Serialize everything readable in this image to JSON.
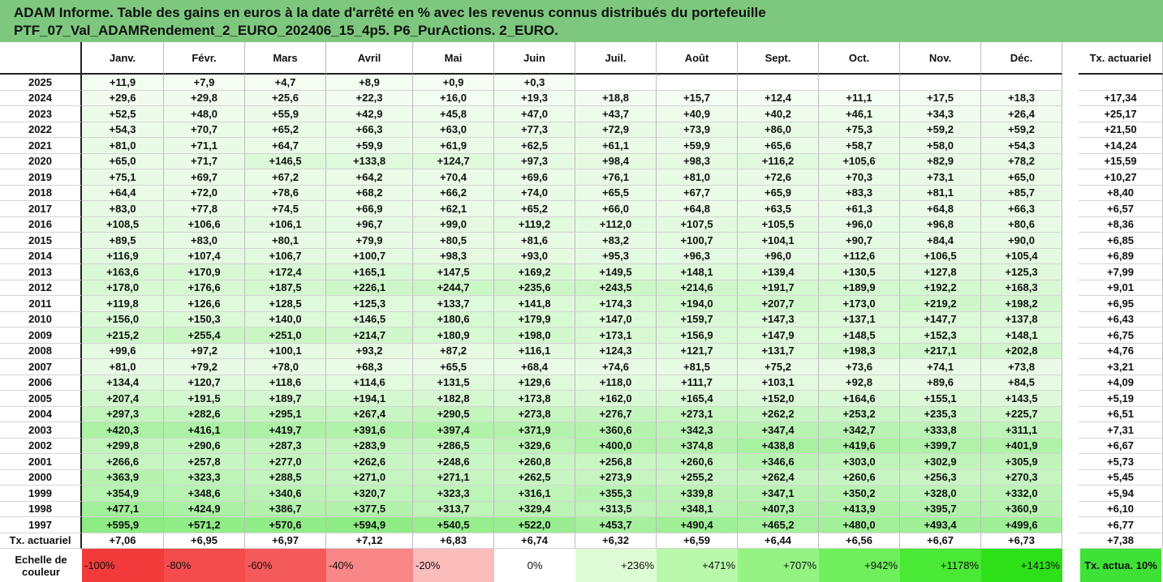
{
  "title": {
    "line1": "ADAM Informe. Table des gains en euros à la date d'arrêté en % avec les revenus connus distribués du portefeuille",
    "line2": "PTF_07_Val_ADAMRendement_2_EURO_202406_15_4p5. P6_PurActions. 2_EURO."
  },
  "months": [
    "Janv.",
    "Févr.",
    "Mars",
    "Avril",
    "Mai",
    "Juin",
    "Juil.",
    "Août",
    "Sept.",
    "Oct.",
    "Nov.",
    "Déc."
  ],
  "rate_header": "Tx. actuariel",
  "rows": [
    {
      "year": "2025",
      "values": [
        "+11,9",
        "+7,9",
        "+4,7",
        "+8,9",
        "+0,9",
        "+0,3",
        "",
        "",
        "",
        "",
        "",
        ""
      ],
      "rate": ""
    },
    {
      "year": "2024",
      "values": [
        "+29,6",
        "+29,8",
        "+25,6",
        "+22,3",
        "+16,0",
        "+19,3",
        "+18,8",
        "+15,7",
        "+12,4",
        "+11,1",
        "+17,5",
        "+18,3"
      ],
      "rate": "+17,34"
    },
    {
      "year": "2023",
      "values": [
        "+52,5",
        "+48,0",
        "+55,9",
        "+42,9",
        "+45,8",
        "+47,0",
        "+43,7",
        "+40,9",
        "+40,2",
        "+46,1",
        "+34,3",
        "+26,4"
      ],
      "rate": "+25,17"
    },
    {
      "year": "2022",
      "values": [
        "+54,3",
        "+70,7",
        "+65,2",
        "+66,3",
        "+63,0",
        "+77,3",
        "+72,9",
        "+73,9",
        "+86,0",
        "+75,3",
        "+59,2",
        "+59,2"
      ],
      "rate": "+21,50"
    },
    {
      "year": "2021",
      "values": [
        "+81,0",
        "+71,1",
        "+64,7",
        "+59,9",
        "+61,9",
        "+62,5",
        "+61,1",
        "+59,9",
        "+65,6",
        "+58,7",
        "+58,0",
        "+54,3"
      ],
      "rate": "+14,24"
    },
    {
      "year": "2020",
      "values": [
        "+65,0",
        "+71,7",
        "+146,5",
        "+133,8",
        "+124,7",
        "+97,3",
        "+98,4",
        "+98,3",
        "+116,2",
        "+105,6",
        "+82,9",
        "+78,2"
      ],
      "rate": "+15,59"
    },
    {
      "year": "2019",
      "values": [
        "+75,1",
        "+69,7",
        "+67,2",
        "+64,2",
        "+70,4",
        "+69,6",
        "+76,1",
        "+81,0",
        "+72,6",
        "+70,3",
        "+73,1",
        "+65,0"
      ],
      "rate": "+10,27"
    },
    {
      "year": "2018",
      "values": [
        "+64,4",
        "+72,0",
        "+78,6",
        "+68,2",
        "+66,2",
        "+74,0",
        "+65,5",
        "+67,7",
        "+65,9",
        "+83,3",
        "+81,1",
        "+85,7"
      ],
      "rate": "+8,40"
    },
    {
      "year": "2017",
      "values": [
        "+83,0",
        "+77,8",
        "+74,5",
        "+66,9",
        "+62,1",
        "+65,2",
        "+66,0",
        "+64,8",
        "+63,5",
        "+61,3",
        "+64,8",
        "+66,3"
      ],
      "rate": "+6,57"
    },
    {
      "year": "2016",
      "values": [
        "+108,5",
        "+106,6",
        "+106,1",
        "+96,7",
        "+99,0",
        "+119,2",
        "+112,0",
        "+107,5",
        "+105,5",
        "+96,0",
        "+96,8",
        "+80,6"
      ],
      "rate": "+8,36"
    },
    {
      "year": "2015",
      "values": [
        "+89,5",
        "+83,0",
        "+80,1",
        "+79,9",
        "+80,5",
        "+81,6",
        "+83,2",
        "+100,7",
        "+104,1",
        "+90,7",
        "+84,4",
        "+90,0"
      ],
      "rate": "+6,85"
    },
    {
      "year": "2014",
      "values": [
        "+116,9",
        "+107,4",
        "+106,7",
        "+100,7",
        "+98,3",
        "+93,0",
        "+95,3",
        "+96,3",
        "+96,0",
        "+112,6",
        "+106,5",
        "+105,4"
      ],
      "rate": "+6,89"
    },
    {
      "year": "2013",
      "values": [
        "+163,6",
        "+170,9",
        "+172,4",
        "+165,1",
        "+147,5",
        "+169,2",
        "+149,5",
        "+148,1",
        "+139,4",
        "+130,5",
        "+127,8",
        "+125,3"
      ],
      "rate": "+7,99"
    },
    {
      "year": "2012",
      "values": [
        "+178,0",
        "+176,6",
        "+187,5",
        "+226,1",
        "+244,7",
        "+235,6",
        "+243,5",
        "+214,6",
        "+191,7",
        "+189,9",
        "+192,2",
        "+168,3"
      ],
      "rate": "+9,01"
    },
    {
      "year": "2011",
      "values": [
        "+119,8",
        "+126,6",
        "+128,5",
        "+125,3",
        "+133,7",
        "+141,8",
        "+174,3",
        "+194,0",
        "+207,7",
        "+173,0",
        "+219,2",
        "+198,2"
      ],
      "rate": "+6,95"
    },
    {
      "year": "2010",
      "values": [
        "+156,0",
        "+150,3",
        "+140,0",
        "+146,5",
        "+180,6",
        "+179,9",
        "+147,0",
        "+159,7",
        "+147,3",
        "+137,1",
        "+147,7",
        "+137,8"
      ],
      "rate": "+6,43"
    },
    {
      "year": "2009",
      "values": [
        "+215,2",
        "+255,4",
        "+251,0",
        "+214,7",
        "+180,9",
        "+198,0",
        "+173,1",
        "+156,9",
        "+147,9",
        "+148,5",
        "+152,3",
        "+148,1"
      ],
      "rate": "+6,75"
    },
    {
      "year": "2008",
      "values": [
        "+99,6",
        "+97,2",
        "+100,1",
        "+93,2",
        "+87,2",
        "+116,1",
        "+124,3",
        "+121,7",
        "+131,7",
        "+198,3",
        "+217,1",
        "+202,8"
      ],
      "rate": "+4,76"
    },
    {
      "year": "2007",
      "values": [
        "+81,0",
        "+79,2",
        "+78,0",
        "+68,3",
        "+65,5",
        "+68,4",
        "+74,6",
        "+81,5",
        "+75,2",
        "+73,6",
        "+74,1",
        "+73,8"
      ],
      "rate": "+3,21"
    },
    {
      "year": "2006",
      "values": [
        "+134,4",
        "+120,7",
        "+118,6",
        "+114,6",
        "+131,5",
        "+129,6",
        "+118,0",
        "+111,7",
        "+103,1",
        "+92,8",
        "+89,6",
        "+84,5"
      ],
      "rate": "+4,09"
    },
    {
      "year": "2005",
      "values": [
        "+207,4",
        "+191,5",
        "+189,7",
        "+194,1",
        "+182,8",
        "+173,8",
        "+162,0",
        "+165,4",
        "+152,0",
        "+164,6",
        "+155,1",
        "+143,5"
      ],
      "rate": "+5,19"
    },
    {
      "year": "2004",
      "values": [
        "+297,3",
        "+282,6",
        "+295,1",
        "+267,4",
        "+290,5",
        "+273,8",
        "+276,7",
        "+273,1",
        "+262,2",
        "+253,2",
        "+235,3",
        "+225,7"
      ],
      "rate": "+6,51"
    },
    {
      "year": "2003",
      "values": [
        "+420,3",
        "+416,1",
        "+419,7",
        "+391,6",
        "+397,4",
        "+371,9",
        "+360,6",
        "+342,3",
        "+347,4",
        "+342,7",
        "+333,8",
        "+311,1"
      ],
      "rate": "+7,31"
    },
    {
      "year": "2002",
      "values": [
        "+299,8",
        "+290,6",
        "+287,3",
        "+283,9",
        "+286,5",
        "+329,6",
        "+400,0",
        "+374,8",
        "+438,8",
        "+419,6",
        "+399,7",
        "+401,9"
      ],
      "rate": "+6,67"
    },
    {
      "year": "2001",
      "values": [
        "+266,6",
        "+257,8",
        "+277,0",
        "+262,6",
        "+248,6",
        "+260,8",
        "+256,8",
        "+260,6",
        "+346,6",
        "+303,0",
        "+302,9",
        "+305,9"
      ],
      "rate": "+5,73"
    },
    {
      "year": "2000",
      "values": [
        "+363,9",
        "+323,3",
        "+288,5",
        "+271,0",
        "+271,1",
        "+262,5",
        "+273,9",
        "+255,2",
        "+262,4",
        "+260,6",
        "+256,3",
        "+270,3"
      ],
      "rate": "+5,45"
    },
    {
      "year": "1999",
      "values": [
        "+354,9",
        "+348,6",
        "+340,6",
        "+320,7",
        "+323,3",
        "+316,1",
        "+355,3",
        "+339,8",
        "+347,1",
        "+350,2",
        "+328,0",
        "+332,0"
      ],
      "rate": "+5,94"
    },
    {
      "year": "1998",
      "values": [
        "+477,1",
        "+424,9",
        "+386,7",
        "+377,5",
        "+313,7",
        "+329,4",
        "+313,5",
        "+348,1",
        "+407,3",
        "+413,9",
        "+395,7",
        "+360,9"
      ],
      "rate": "+6,10"
    },
    {
      "year": "1997",
      "values": [
        "+595,9",
        "+571,2",
        "+570,6",
        "+594,9",
        "+540,5",
        "+522,0",
        "+453,7",
        "+490,4",
        "+465,2",
        "+480,0",
        "+493,4",
        "+499,6"
      ],
      "rate": "+6,77"
    }
  ],
  "rate_row": {
    "label": "Tx. actuariel",
    "values": [
      "+7,06",
      "+6,95",
      "+6,97",
      "+7,12",
      "+6,83",
      "+6,74",
      "+6,32",
      "+6,59",
      "+6,44",
      "+6,56",
      "+6,67",
      "+6,73"
    ],
    "total": "+7,38"
  },
  "scale": {
    "label_line1": "Echelle de",
    "label_line2": "couleur",
    "items": [
      {
        "text": "-100%",
        "color": "#f23a3a"
      },
      {
        "text": "-80%",
        "color": "#f44c4c"
      },
      {
        "text": "-60%",
        "color": "#f55a5a"
      },
      {
        "text": "-40%",
        "color": "#f98787"
      },
      {
        "text": "-20%",
        "color": "#fbbcbc"
      },
      {
        "text": "0%",
        "color": "#ffffff"
      },
      {
        "text": "+236%",
        "color": "#ddfbd5"
      },
      {
        "text": "+471%",
        "color": "#b9f7ab"
      },
      {
        "text": "+707%",
        "color": "#95f384"
      },
      {
        "text": "+942%",
        "color": "#6fef5c"
      },
      {
        "text": "+1178%",
        "color": "#4ae936"
      },
      {
        "text": "+1413%",
        "color": "#2de018"
      }
    ],
    "rate_text": "Tx. actua. 10%",
    "rate_color": "#3ee236"
  }
}
